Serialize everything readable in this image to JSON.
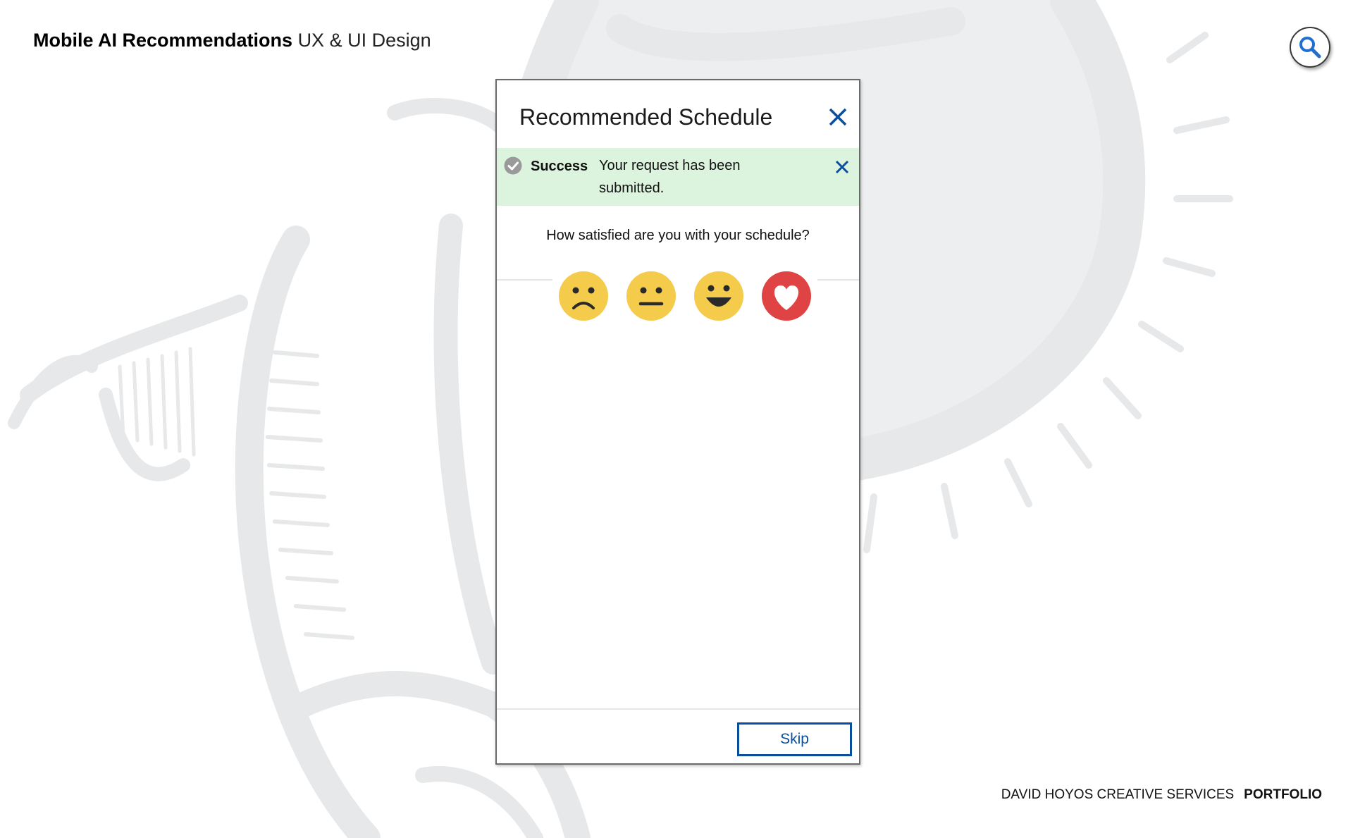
{
  "header": {
    "title_bold": "Mobile AI Recommendations",
    "title_light": "UX & UI Design"
  },
  "search": {
    "icon": "search-icon",
    "color": "#1f6fd1"
  },
  "modal": {
    "title": "Recommended Schedule",
    "close_icon": "close-icon",
    "alert": {
      "status": "success",
      "icon": "check-circle-icon",
      "label": "Success",
      "message": "Your request has been submitted.",
      "background": "#dcf3dd",
      "close_icon": "close-icon"
    },
    "question": "How satisfied are you with your schedule?",
    "ratings": [
      {
        "name": "sad",
        "icon": "sad-face-icon",
        "color": "#f5cb4b"
      },
      {
        "name": "neutral",
        "icon": "neutral-face-icon",
        "color": "#f5cb4b"
      },
      {
        "name": "happy",
        "icon": "happy-face-icon",
        "color": "#f5cb4b"
      },
      {
        "name": "love",
        "icon": "heart-icon",
        "color": "#e04343"
      }
    ],
    "skip_label": "Skip",
    "accent_color": "#0a4f9e"
  },
  "footer": {
    "credit": "DAVID HOYOS CREATIVE SERVICES",
    "portfolio": "PORTFOLIO"
  }
}
